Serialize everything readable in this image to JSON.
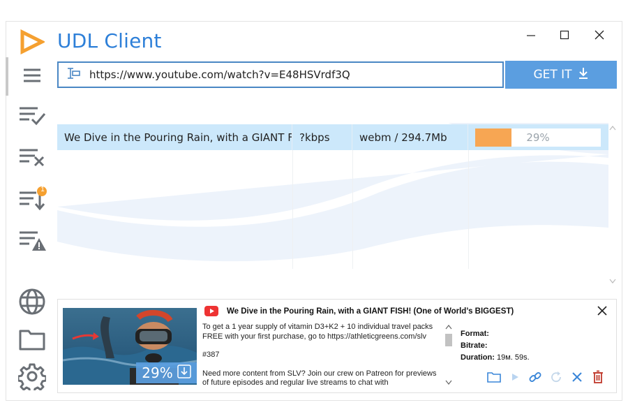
{
  "app": {
    "title": "UDL Client"
  },
  "window_controls": {
    "minimize": "—",
    "maximize": "☐",
    "close": "✕"
  },
  "url_bar": {
    "value": "https://www.youtube.com/watch?v=E48HSVrdf3Q"
  },
  "get_button": {
    "label": "GET IT"
  },
  "downloads": [
    {
      "title": "We Dive in the Pouring Rain, with a GIANT FI...",
      "bitrate": "?kbps",
      "format": "webm / 294.7Mb",
      "progress_label": "29%",
      "progress": 0.29
    }
  ],
  "sidebar": {
    "badge_count": "1"
  },
  "detail": {
    "title": "We Dive in the Pouring Rain, with a GIANT FISH! (One of World’s BIGGEST)",
    "progress_label": "29%",
    "description": [
      "To get a 1 year supply of vitamin D3+K2 + 10 individual travel packs FREE with your first purchase, go to https://athleticgreens.com/slv",
      "#387",
      "Need more content from SLV? Join our crew on Patreon for previews of future episodes and regular live streams to chat with"
    ],
    "format_label": "Format:",
    "format_value": "",
    "bitrate_label": "Bitrate:",
    "bitrate_value": "",
    "duration_label": "Duration:",
    "duration_value": "19м. 59s."
  },
  "colors": {
    "accent": "#2d7fd8",
    "button": "#5b9ee0",
    "selection": "#cce8fb",
    "progress": "#f7a653",
    "logo": "#f5a030",
    "delete": "#c0392b"
  }
}
